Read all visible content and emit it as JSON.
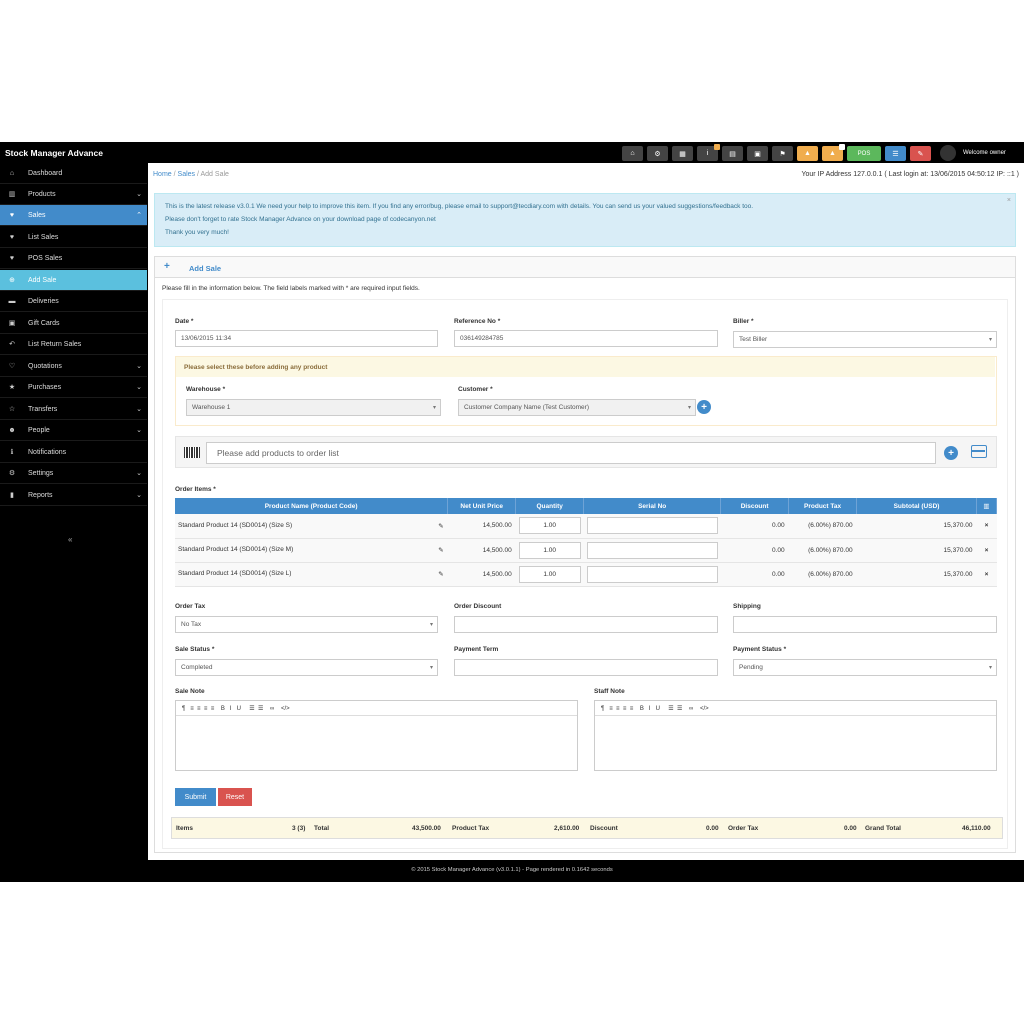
{
  "app": {
    "title": "Stock Manager Advance",
    "welcome": "Welcome owner"
  },
  "topbar": {
    "pos_label": "POS",
    "icons": [
      "dashboard-icon",
      "settings-icon",
      "calculator-icon",
      "info-icon",
      "calendar-icon",
      "print-icon",
      "flag-icon",
      "alert-icon",
      "alert-icon",
      "pos-icon",
      "list-icon",
      "eraser-icon"
    ]
  },
  "sidebar": {
    "items": [
      {
        "label": "Dashboard",
        "icon": "dashboard-icon"
      },
      {
        "label": "Products",
        "icon": "barcode-icon"
      },
      {
        "label": "Sales",
        "icon": "heart-icon"
      },
      {
        "label": "List Sales",
        "icon": "heart-icon"
      },
      {
        "label": "POS Sales",
        "icon": "heart-icon"
      },
      {
        "label": "Add Sale",
        "icon": "plus-circle-icon"
      },
      {
        "label": "Deliveries",
        "icon": "truck-icon"
      },
      {
        "label": "Gift Cards",
        "icon": "gift-icon"
      },
      {
        "label": "List Return Sales",
        "icon": "return-icon"
      },
      {
        "label": "Quotations",
        "icon": "heart-outline-icon"
      },
      {
        "label": "Purchases",
        "icon": "star-icon"
      },
      {
        "label": "Transfers",
        "icon": "star-outline-icon"
      },
      {
        "label": "People",
        "icon": "users-icon"
      },
      {
        "label": "Notifications",
        "icon": "info-icon"
      },
      {
        "label": "Settings",
        "icon": "cog-icon"
      },
      {
        "label": "Reports",
        "icon": "bar-chart-icon"
      }
    ],
    "collapse": "«"
  },
  "breadcrumb": {
    "home": "Home",
    "sales": "Sales",
    "current": "Add Sale"
  },
  "ipinfo": "Your IP Address 127.0.0.1 ( Last login at: 13/06/2015 04:50:12 IP: ::1 )",
  "alert": {
    "line1": "This is the latest release v3.0.1 We need your help to improve this item. If you find any error/bug, please email to support@tecdiary.com with details. You can send us your valued suggestions/feedback too.",
    "line2": "Please don't forget to rate Stock Manager Advance on your download page of codecanyon.net",
    "line3": "Thank you very much!",
    "close": "×"
  },
  "form": {
    "header": "Add Sale",
    "intro": "Please fill in the information below. The field labels marked with * are required input fields.",
    "date_label": "Date *",
    "date_value": "13/06/2015 11:34",
    "ref_label": "Reference No *",
    "ref_value": "036149284785",
    "biller_label": "Biller *",
    "biller_value": "Test Biller",
    "warn_text": "Please select these before adding any product",
    "warehouse_label": "Warehouse *",
    "warehouse_value": "Warehouse 1",
    "customer_label": "Customer *",
    "customer_value": "Customer Company Name (Test Customer)",
    "product_placeholder": "Please add products to order list",
    "order_items_label": "Order Items *",
    "order_tax_label": "Order Tax",
    "order_tax_value": "No Tax",
    "order_discount_label": "Order Discount",
    "shipping_label": "Shipping",
    "sale_status_label": "Sale Status *",
    "sale_status_value": "Completed",
    "payment_term_label": "Payment Term",
    "payment_status_label": "Payment Status *",
    "payment_status_value": "Pending",
    "sale_note_label": "Sale Note",
    "staff_note_label": "Staff Note",
    "editor_tools": "¶   ≡  ≡  ≡  ≡    B   I   U     ☰  ☰    ∞    </>",
    "submit": "Submit",
    "reset": "Reset"
  },
  "table": {
    "headers": [
      "Product Name (Product Code)",
      "Net Unit Price",
      "Quantity",
      "Serial No",
      "Discount",
      "Product Tax",
      "Subtotal (USD)"
    ],
    "rows": [
      {
        "name": "Standard Product 14 (SD0014) (Size S)",
        "price": "14,500.00",
        "qty": "1.00",
        "discount": "0.00",
        "tax": "(6.00%) 870.00",
        "subtotal": "15,370.00"
      },
      {
        "name": "Standard Product 14 (SD0014) (Size M)",
        "price": "14,500.00",
        "qty": "1.00",
        "discount": "0.00",
        "tax": "(6.00%) 870.00",
        "subtotal": "15,370.00"
      },
      {
        "name": "Standard Product 14 (SD0014) (Size L)",
        "price": "14,500.00",
        "qty": "1.00",
        "discount": "0.00",
        "tax": "(6.00%) 870.00",
        "subtotal": "15,370.00"
      }
    ],
    "remove": "×"
  },
  "totals": {
    "items_label": "Items",
    "items_value": "3 (3)",
    "total_label": "Total",
    "total_value": "43,500.00",
    "ptax_label": "Product Tax",
    "ptax_value": "2,610.00",
    "discount_label": "Discount",
    "discount_value": "0.00",
    "otax_label": "Order Tax",
    "otax_value": "0.00",
    "grand_label": "Grand Total",
    "grand_value": "46,110.00"
  },
  "footer": "© 2015 Stock Manager Advance (v3.0.1.1) - Page rendered in 0.1642 seconds",
  "colors": {
    "primary": "#428bca",
    "info": "#5bc0de",
    "danger": "#d9534f",
    "warning": "#f0ad4e",
    "success": "#5cb85c"
  }
}
